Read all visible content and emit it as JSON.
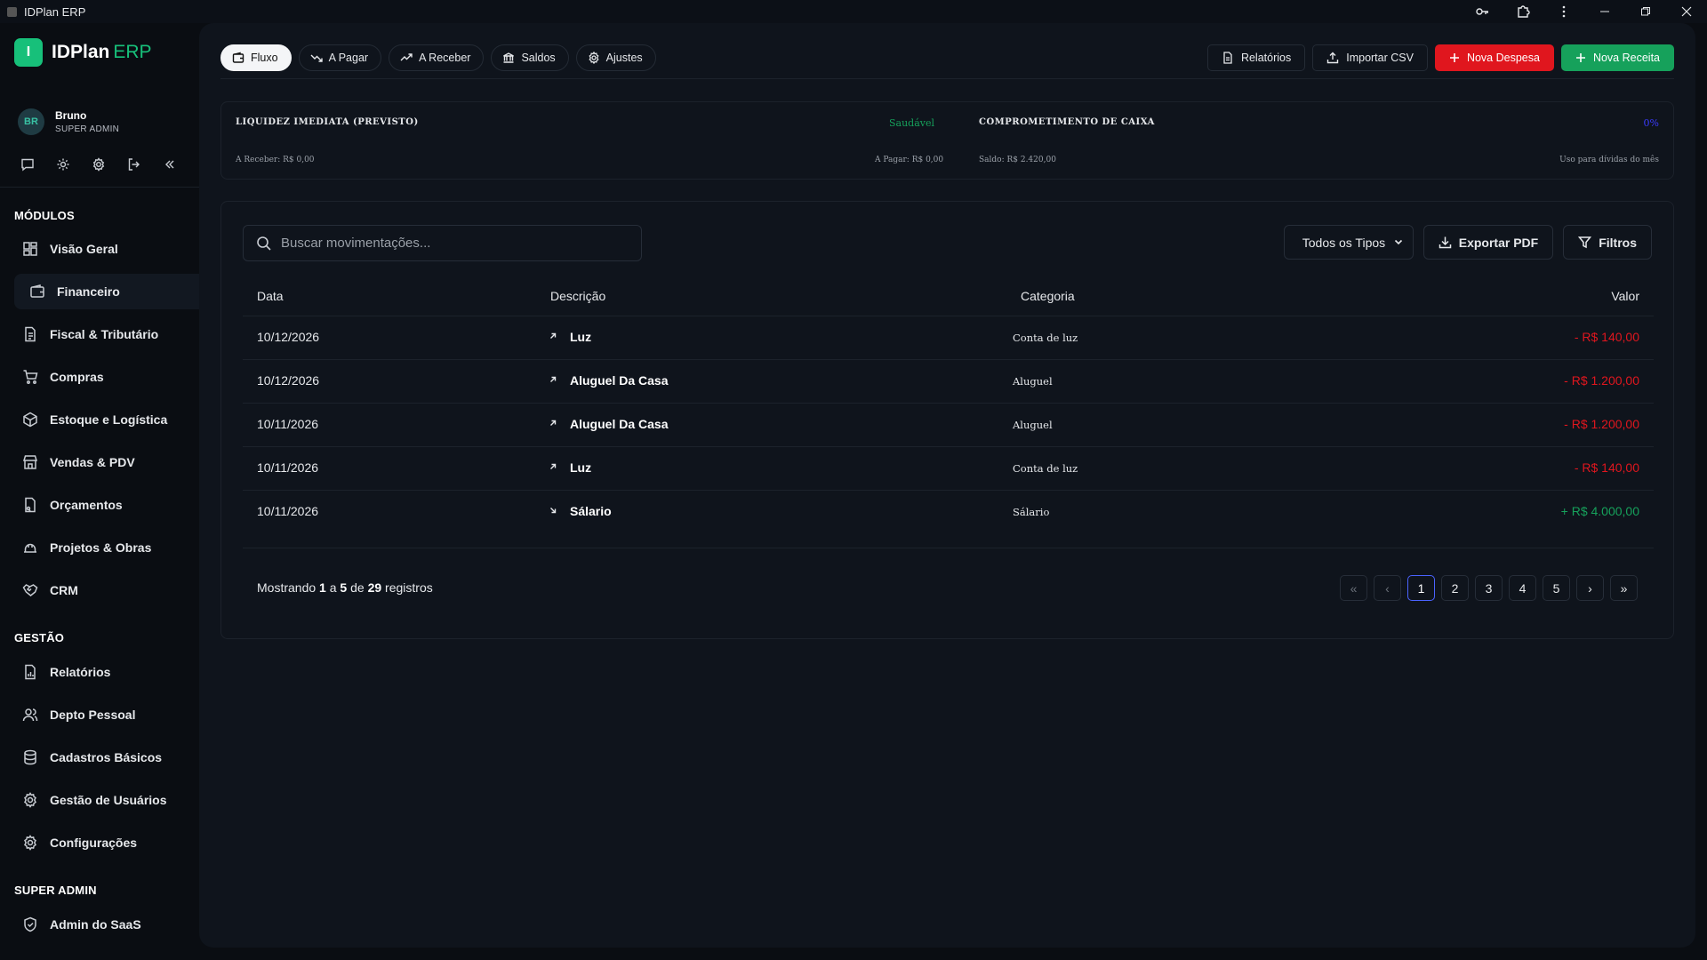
{
  "window": {
    "title": "IDPlan ERP"
  },
  "brand": {
    "initial": "I",
    "name": "IDPlan",
    "suffix": "ERP"
  },
  "user": {
    "initials": "BR",
    "name": "Bruno",
    "role": "SUPER ADMIN"
  },
  "sidebar": {
    "modules_title": "MÓDULOS",
    "modules": [
      {
        "label": "Visão Geral",
        "icon": "grid-icon"
      },
      {
        "label": "Financeiro",
        "icon": "wallet-icon",
        "active": true
      },
      {
        "label": "Fiscal & Tributário",
        "icon": "document-icon"
      },
      {
        "label": "Compras",
        "icon": "cart-icon"
      },
      {
        "label": "Estoque e Logística",
        "icon": "box-icon"
      },
      {
        "label": "Vendas & PDV",
        "icon": "store-icon"
      },
      {
        "label": "Orçamentos",
        "icon": "quote-icon"
      },
      {
        "label": "Projetos & Obras",
        "icon": "helmet-icon"
      },
      {
        "label": "CRM",
        "icon": "handshake-icon"
      }
    ],
    "management_title": "GESTÃO",
    "management": [
      {
        "label": "Relatórios",
        "icon": "report-icon"
      },
      {
        "label": "Depto Pessoal",
        "icon": "users-icon"
      },
      {
        "label": "Cadastros Básicos",
        "icon": "database-icon"
      },
      {
        "label": "Gestão de Usuários",
        "icon": "gear-icon"
      },
      {
        "label": "Configurações",
        "icon": "settings-icon"
      }
    ],
    "admin_title": "SUPER ADMIN",
    "admin": [
      {
        "label": "Admin do SaaS",
        "icon": "shield-icon"
      }
    ]
  },
  "tabs": [
    {
      "label": "Fluxo",
      "icon": "wallet-icon",
      "active": true
    },
    {
      "label": "A Pagar",
      "icon": "trend-down-icon"
    },
    {
      "label": "A Receber",
      "icon": "trend-up-icon"
    },
    {
      "label": "Saldos",
      "icon": "bank-icon"
    },
    {
      "label": "Ajustes",
      "icon": "gear-icon"
    }
  ],
  "actions": {
    "reports": "Relatórios",
    "import_csv": "Importar CSV",
    "new_expense": "Nova Despesa",
    "new_income": "Nova Receita"
  },
  "kpi": {
    "liquidity_label": "LIQUIDEZ IMEDIATA (PREVISTO)",
    "liquidity_status": "Saudável",
    "receivable": "A Receber: R$ 0,00",
    "payable": "A Pagar: R$ 0,00",
    "commitment_label": "COMPROMETIMENTO DE CAIXA",
    "commitment_pct": "0%",
    "balance": "Saldo: R$ 2.420,00",
    "commitment_note": "Uso para dívidas do mês"
  },
  "search": {
    "placeholder": "Buscar movimentações..."
  },
  "filters": {
    "type_selected": "Todos os Tipos",
    "export_pdf": "Exportar PDF",
    "filters": "Filtros"
  },
  "table": {
    "columns": [
      "Data",
      "Descrição",
      "Categoria",
      "Valor"
    ],
    "rows": [
      {
        "date": "10/12/2026",
        "direction": "out",
        "description": "Luz",
        "category": "Conta de luz",
        "value": "- R$ 140,00"
      },
      {
        "date": "10/12/2026",
        "direction": "out",
        "description": "Aluguel Da Casa",
        "category": "Aluguel",
        "value": "- R$ 1.200,00"
      },
      {
        "date": "10/11/2026",
        "direction": "out",
        "description": "Aluguel Da Casa",
        "category": "Aluguel",
        "value": "- R$ 1.200,00"
      },
      {
        "date": "10/11/2026",
        "direction": "out",
        "description": "Luz",
        "category": "Conta de luz",
        "value": "- R$ 140,00"
      },
      {
        "date": "10/11/2026",
        "direction": "in",
        "description": "Sálario",
        "category": "Sálario",
        "value": "+ R$ 4.000,00"
      }
    ]
  },
  "pagination": {
    "showing_prefix": "Mostrando",
    "from": "1",
    "to_word": "a",
    "to": "5",
    "of_word": "de",
    "total": "29",
    "suffix": "registros",
    "first": "«",
    "prev": "‹",
    "pages": [
      "1",
      "2",
      "3",
      "4",
      "5"
    ],
    "current": "1",
    "next": "›",
    "last": "»"
  },
  "colors": {
    "accent_green": "#16a15b",
    "danger_red": "#e0161e",
    "brand_green": "#17c07a",
    "page_active": "#4b63ff"
  }
}
